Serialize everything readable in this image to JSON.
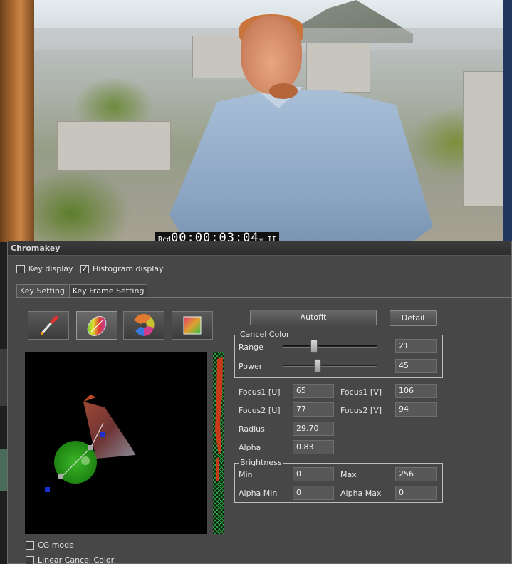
{
  "preview": {
    "timecode": "00:00:03:04",
    "rec_label": "Rcd",
    "tc_suffix": "✳  II"
  },
  "dialog": {
    "title": "Chromakey",
    "key_display": {
      "label": "Key display",
      "checked": false
    },
    "histogram_display": {
      "label": "Histogram display",
      "checked": true
    },
    "tabs": [
      {
        "label": "Key Setting",
        "active": true
      },
      {
        "label": "Key Frame Setting",
        "active": false
      }
    ],
    "tools": [
      {
        "icon": "eyedropper-icon",
        "pressed": false
      },
      {
        "icon": "color-ellipse-icon",
        "pressed": true
      },
      {
        "icon": "color-wheel-icon",
        "pressed": false
      },
      {
        "icon": "color-square-icon",
        "pressed": false
      }
    ],
    "autofit_label": "Autofit",
    "detail_label": "Detail",
    "cancel_color": {
      "group_label": "Cancel Color",
      "range": {
        "label": "Range",
        "value": "21",
        "fraction": 0.33
      },
      "power": {
        "label": "Power",
        "value": "45",
        "fraction": 0.37
      }
    },
    "focus1_u": {
      "label": "Focus1 [U]",
      "value": "65"
    },
    "focus1_v": {
      "label": "Focus1 [V]",
      "value": "106"
    },
    "focus2_u": {
      "label": "Focus2 [U]",
      "value": "77"
    },
    "focus2_v": {
      "label": "Focus2 [V]",
      "value": "94"
    },
    "radius": {
      "label": "Radius",
      "value": "29.70"
    },
    "alpha": {
      "label": "Alpha",
      "value": "0.83"
    },
    "brightness": {
      "group_label": "Brightness",
      "min": {
        "label": "Min",
        "value": "0"
      },
      "max": {
        "label": "Max",
        "value": "256"
      },
      "alpha_min": {
        "label": "Alpha Min",
        "value": "0"
      },
      "alpha_max": {
        "label": "Alpha Max",
        "value": "0"
      }
    },
    "cg_mode": {
      "label": "CG mode",
      "checked": false
    },
    "linear_cancel_color": {
      "label": "Linear Cancel Color",
      "checked": false
    }
  }
}
